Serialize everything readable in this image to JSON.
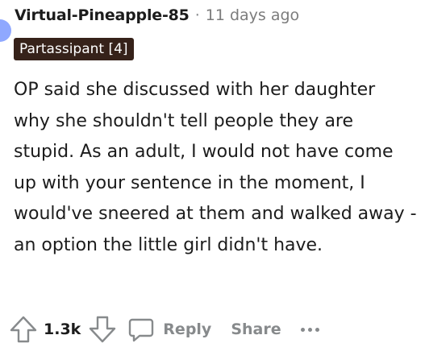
{
  "comment": {
    "author": "Virtual-Pineapple-85",
    "separator": "·",
    "timestamp": "11 days ago",
    "flair": "Partassipant [4]",
    "body": "OP said she discussed with her daughter why she shouldn't tell people they are stupid. As an adult, I would not have come up with your sentence in the moment, I would've sneered at them and walked away - an option the little girl didn't have."
  },
  "actions": {
    "upvote_icon": "arrow-up-icon",
    "score": "1.3k",
    "downvote_icon": "arrow-down-icon",
    "reply_icon": "speech-bubble-icon",
    "reply_label": "Reply",
    "share_label": "Share",
    "more_icon": "ellipsis-icon"
  },
  "colors": {
    "flair_background": "#36221a",
    "muted_text": "#878a8c",
    "avatar": "#8fa8ff"
  }
}
